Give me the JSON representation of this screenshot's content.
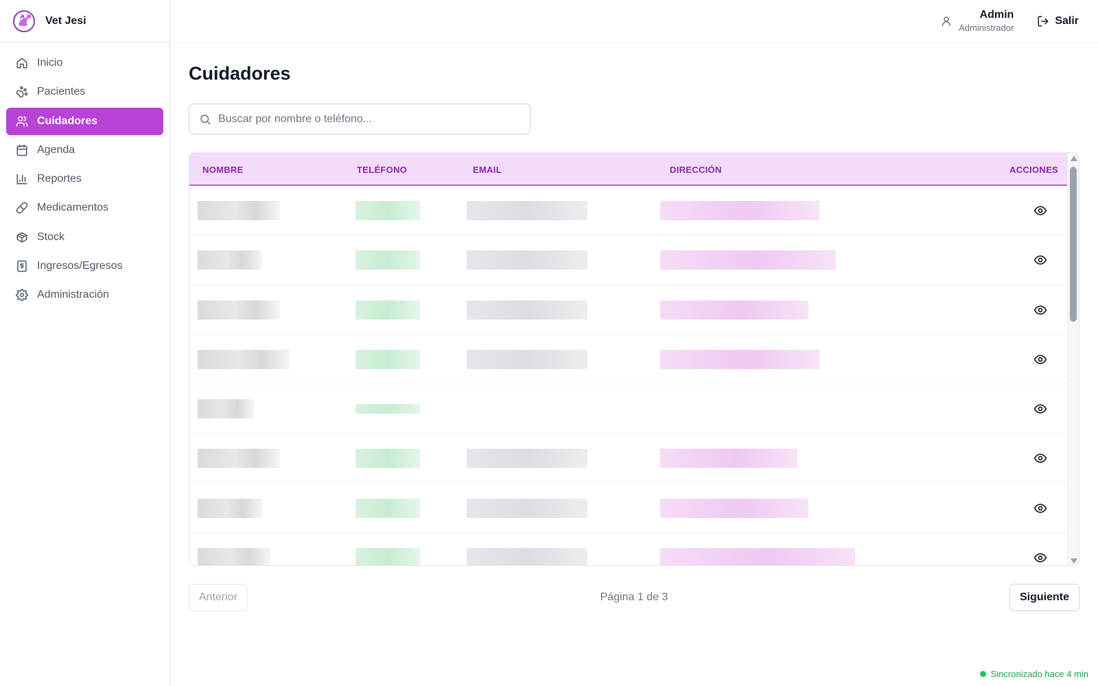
{
  "brand": {
    "name": "Vet Jesi",
    "logo_icon": "veterinary-logo-icon",
    "accent": "#b843d6"
  },
  "sidebar": {
    "items": [
      {
        "label": "Inicio",
        "icon": "home-icon",
        "active": false
      },
      {
        "label": "Pacientes",
        "icon": "paw-icon",
        "active": false
      },
      {
        "label": "Cuidadores",
        "icon": "users-icon",
        "active": true
      },
      {
        "label": "Agenda",
        "icon": "calendar-icon",
        "active": false
      },
      {
        "label": "Reportes",
        "icon": "bar-chart-icon",
        "active": false
      },
      {
        "label": "Medicamentos",
        "icon": "pill-icon",
        "active": false
      },
      {
        "label": "Stock",
        "icon": "package-icon",
        "active": false
      },
      {
        "label": "Ingresos/Egresos",
        "icon": "receipt-icon",
        "active": false
      },
      {
        "label": "Administración",
        "icon": "gear-icon",
        "active": false
      }
    ]
  },
  "header": {
    "user_name": "Admin",
    "user_role": "Administrador",
    "logout_label": "Salir"
  },
  "main": {
    "title": "Cuidadores",
    "search_placeholder": "Buscar por nombre o teléfono...",
    "table": {
      "columns": [
        "NOMBRE",
        "TELÉFONO",
        "EMAIL",
        "DIRECCIÓN",
        "ACCIONES"
      ],
      "rows_visible": 8,
      "row_action_icon": "eye-icon",
      "cell_values_note": "pixelated"
    },
    "pagination": {
      "prev_label": "Anterior",
      "page_info": "Página 1 de 3",
      "next_label": "Siguiente"
    }
  },
  "status": {
    "sync_text": "Sincronizado hace 4 min",
    "sync_color": "#22c55e"
  }
}
